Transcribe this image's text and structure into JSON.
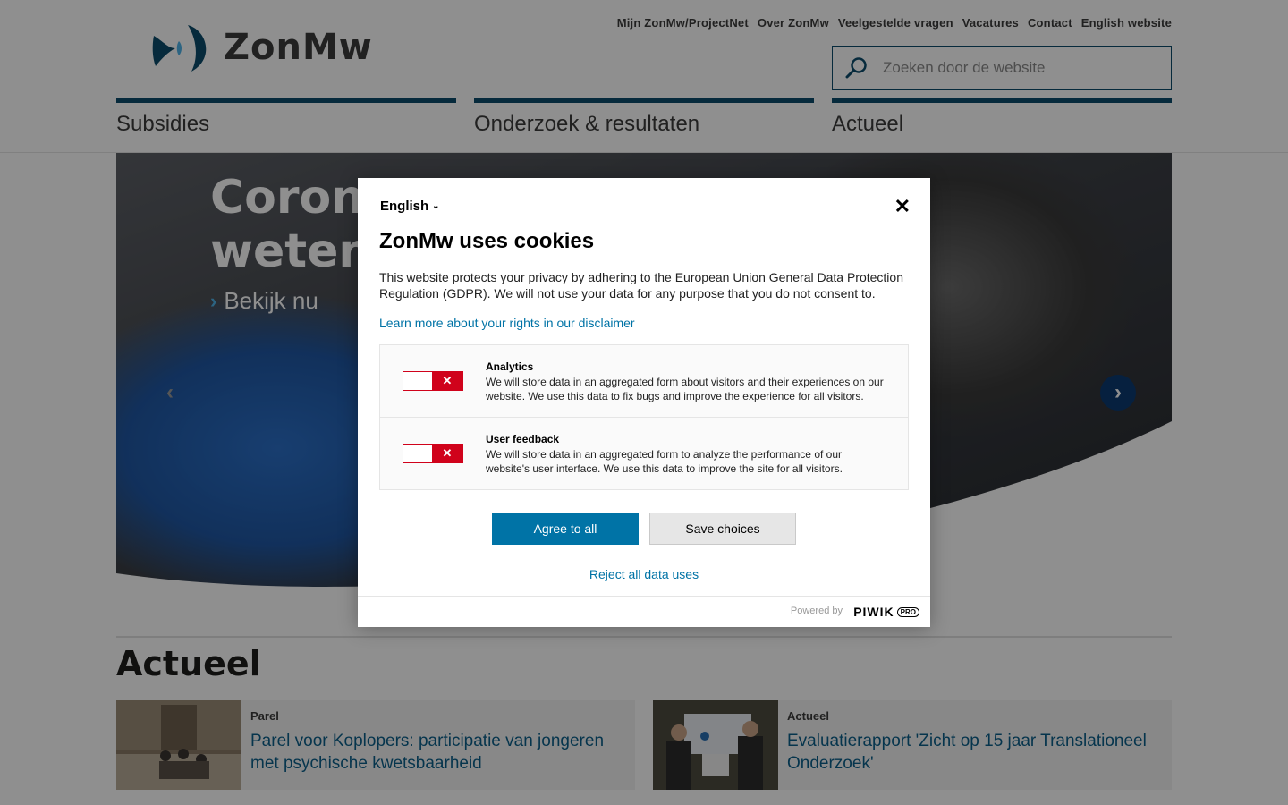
{
  "brand": {
    "name": "ZonMw",
    "logo_icon": "zonmw-logo-icon"
  },
  "top_nav": [
    {
      "label": "Mijn ZonMw/ProjectNet"
    },
    {
      "label": "Over ZonMw"
    },
    {
      "label": "Veelgestelde vragen"
    },
    {
      "label": "Vacatures"
    },
    {
      "label": "Contact"
    },
    {
      "label": "English website"
    }
  ],
  "search": {
    "placeholder": "Zoeken door de website",
    "value": "",
    "icon": "search-icon"
  },
  "main_nav": [
    {
      "label": "Subsidies"
    },
    {
      "label": "Onderzoek & resultaten"
    },
    {
      "label": "Actueel"
    }
  ],
  "hero": {
    "title_line1": "Corona",
    "title_line2": "wetens",
    "link": "Bekijk nu",
    "prev_icon": "chevron-left-icon",
    "next_icon": "chevron-right-icon"
  },
  "news": {
    "section_title": "Actueel",
    "items": [
      {
        "category": "Parel",
        "title": "Parel voor Koplopers: participatie van jongeren met psychische kwetsbaarheid"
      },
      {
        "category": "Actueel",
        "title": "Evaluatierapport 'Zicht op 15 jaar Translationeel Onderzoek'"
      }
    ]
  },
  "cookie_modal": {
    "language": "English",
    "title": "ZonMw uses cookies",
    "intro": "This website protects your privacy by adhering to the European Union General Data Protection Regulation (GDPR). We will not use your data for any purpose that you do not consent to.",
    "disclaimer_link": "Learn more about your rights in our disclaimer",
    "options": [
      {
        "name": "Analytics",
        "description": "We will store data in an aggregated form about visitors and their experiences on our website. We use this data to fix bugs and improve the experience for all visitors.",
        "enabled": false
      },
      {
        "name": "User feedback",
        "description": "We will store data in an aggregated form to analyze the performance of our website's user interface. We use this data to improve the site for all visitors.",
        "enabled": false
      }
    ],
    "agree_label": "Agree to all",
    "save_label": "Save choices",
    "reject_label": "Reject all data uses",
    "powered_by": "Powered by",
    "powered_brand": "PIWIK",
    "powered_brand_suffix": "PRO"
  },
  "colors": {
    "brand_dark": "#0b4c6b",
    "link_blue": "#0073a6",
    "toggle_off_red": "#d0021b"
  }
}
